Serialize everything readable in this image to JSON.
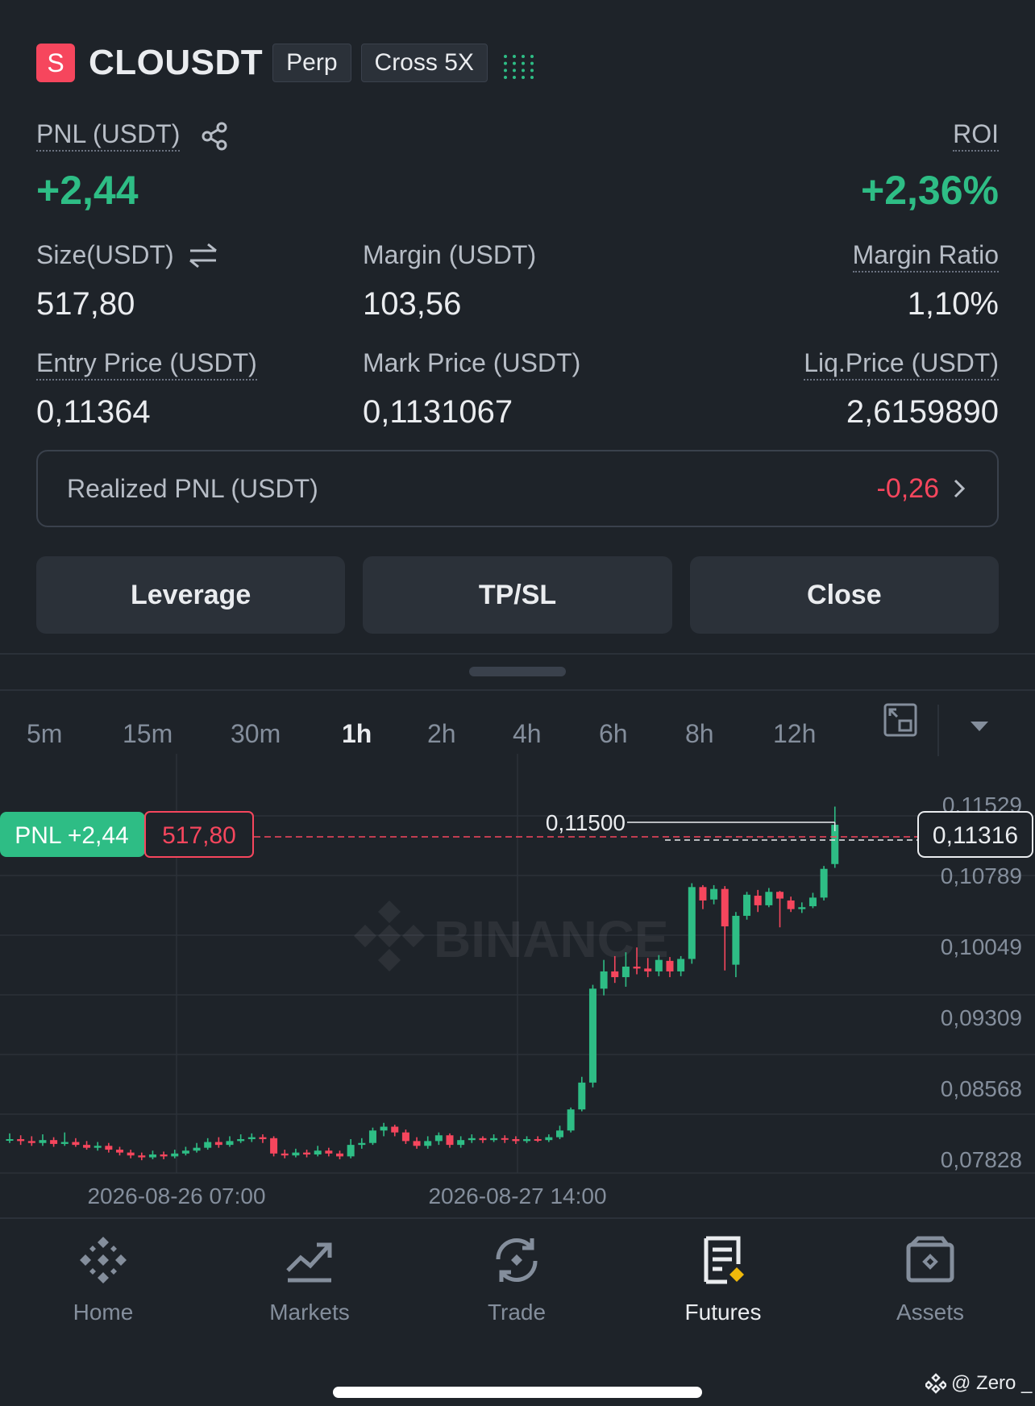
{
  "header": {
    "badge_letter": "S",
    "symbol": "CLOUSDT",
    "tag_contract": "Perp",
    "tag_margin": "Cross 5X"
  },
  "pnl": {
    "label": "PNL (USDT)",
    "value": "+2,44",
    "roi_label": "ROI",
    "roi_value": "+2,36%"
  },
  "stats": {
    "size_label": "Size(USDT)",
    "size_value": "517,80",
    "margin_label": "Margin (USDT)",
    "margin_value": "103,56",
    "margin_ratio_label": "Margin Ratio",
    "margin_ratio_value": "1,10%",
    "entry_label": "Entry Price (USDT)",
    "entry_value": "0,11364",
    "mark_label": "Mark Price (USDT)",
    "mark_value": "0,1131067",
    "liq_label": "Liq.Price (USDT)",
    "liq_value": "2,6159890"
  },
  "realized": {
    "label": "Realized PNL (USDT)",
    "value": "-0,26"
  },
  "buttons": {
    "leverage": "Leverage",
    "tpsl": "TP/SL",
    "close": "Close"
  },
  "timeframes": [
    "5m",
    "15m",
    "30m",
    "1h",
    "2h",
    "4h",
    "6h",
    "8h",
    "12h"
  ],
  "active_timeframe": "1h",
  "chart": {
    "watermark": "BINANCE",
    "pnl_tag_label": "PNL +2,44",
    "pnl_tag_size": "517,80",
    "high_label": "0,11500",
    "current_price": "0,11316",
    "y_labels": [
      "0,11529",
      "0,10789",
      "0,10049",
      "0,09309",
      "0,08568",
      "0,07828"
    ],
    "x_labels": [
      "2026-08-26 07:00",
      "2026-08-27 14:00"
    ],
    "colors": {
      "up": "#2ebd85",
      "down": "#f6465d"
    }
  },
  "chart_data": {
    "type": "candlestick",
    "ylim": [
      0.07828,
      0.11529
    ],
    "y_ticks": [
      0.11529,
      0.10789,
      0.10049,
      0.09309,
      0.08568,
      0.07828
    ],
    "x_ticks": [
      "2026-08-26 07:00",
      "2026-08-27 14:00"
    ],
    "entry_price": 0.11364,
    "current_price": 0.11316,
    "high_marker": 0.115,
    "candles": [
      [
        0.0802,
        0.0803,
        0.0809,
        0.0799
      ],
      [
        0.0803,
        0.0801,
        0.0807,
        0.0797
      ],
      [
        0.0801,
        0.0799,
        0.0806,
        0.0796
      ],
      [
        0.0799,
        0.0802,
        0.0808,
        0.0796
      ],
      [
        0.0802,
        0.0798,
        0.0805,
        0.0795
      ],
      [
        0.0798,
        0.08,
        0.081,
        0.0796
      ],
      [
        0.08,
        0.0797,
        0.0804,
        0.0795
      ],
      [
        0.0797,
        0.0794,
        0.0801,
        0.0792
      ],
      [
        0.0794,
        0.0796,
        0.08,
        0.0791
      ],
      [
        0.0796,
        0.0792,
        0.0799,
        0.0789
      ],
      [
        0.0792,
        0.0789,
        0.0795,
        0.0786
      ],
      [
        0.0789,
        0.0786,
        0.0792,
        0.0783
      ],
      [
        0.0786,
        0.0784,
        0.0789,
        0.0781
      ],
      [
        0.0784,
        0.0787,
        0.0791,
        0.0782
      ],
      [
        0.0787,
        0.0785,
        0.079,
        0.0782
      ],
      [
        0.0785,
        0.0788,
        0.0792,
        0.0783
      ],
      [
        0.0788,
        0.0791,
        0.0795,
        0.0786
      ],
      [
        0.0791,
        0.0794,
        0.0799,
        0.0789
      ],
      [
        0.0794,
        0.08,
        0.0804,
        0.0792
      ],
      [
        0.08,
        0.0797,
        0.0805,
        0.0794
      ],
      [
        0.0797,
        0.0801,
        0.0806,
        0.0795
      ],
      [
        0.0801,
        0.0803,
        0.0808,
        0.0799
      ],
      [
        0.0803,
        0.0805,
        0.0809,
        0.08
      ],
      [
        0.0805,
        0.0803,
        0.0808,
        0.0799
      ],
      [
        0.0804,
        0.0788,
        0.0806,
        0.0785
      ],
      [
        0.0788,
        0.0786,
        0.0792,
        0.0783
      ],
      [
        0.0786,
        0.0789,
        0.0793,
        0.0784
      ],
      [
        0.0789,
        0.0787,
        0.0792,
        0.0784
      ],
      [
        0.0787,
        0.0791,
        0.0796,
        0.0785
      ],
      [
        0.0791,
        0.0788,
        0.0794,
        0.0785
      ],
      [
        0.0788,
        0.0785,
        0.0791,
        0.0782
      ],
      [
        0.0785,
        0.0797,
        0.0803,
        0.0783
      ],
      [
        0.0797,
        0.0799,
        0.0804,
        0.0793
      ],
      [
        0.0799,
        0.0812,
        0.0815,
        0.0797
      ],
      [
        0.0812,
        0.0816,
        0.082,
        0.0806
      ],
      [
        0.0816,
        0.081,
        0.0818,
        0.0806
      ],
      [
        0.081,
        0.0801,
        0.0813,
        0.0798
      ],
      [
        0.0801,
        0.0796,
        0.0805,
        0.0793
      ],
      [
        0.0796,
        0.0801,
        0.0806,
        0.0793
      ],
      [
        0.0801,
        0.0807,
        0.081,
        0.0797
      ],
      [
        0.0807,
        0.0797,
        0.0809,
        0.0794
      ],
      [
        0.0797,
        0.0802,
        0.0806,
        0.0794
      ],
      [
        0.0802,
        0.0804,
        0.0808,
        0.0799
      ],
      [
        0.0804,
        0.0802,
        0.0806,
        0.0799
      ],
      [
        0.0802,
        0.0804,
        0.0808,
        0.08
      ],
      [
        0.0804,
        0.0803,
        0.0807,
        0.0799
      ],
      [
        0.0803,
        0.0801,
        0.0806,
        0.0798
      ],
      [
        0.0801,
        0.0803,
        0.0806,
        0.0799
      ],
      [
        0.0803,
        0.0802,
        0.0806,
        0.08
      ],
      [
        0.0802,
        0.0805,
        0.0808,
        0.08
      ],
      [
        0.0805,
        0.0812,
        0.0817,
        0.0803
      ],
      [
        0.0812,
        0.0834,
        0.0836,
        0.081
      ],
      [
        0.0834,
        0.0862,
        0.0868,
        0.0832
      ],
      [
        0.0862,
        0.096,
        0.0964,
        0.0857
      ],
      [
        0.096,
        0.0978,
        0.099,
        0.0953
      ],
      [
        0.0978,
        0.0972,
        0.0994,
        0.0966
      ],
      [
        0.0972,
        0.0983,
        0.0998,
        0.0962
      ],
      [
        0.0983,
        0.0981,
        0.1003,
        0.0975
      ],
      [
        0.0981,
        0.0978,
        0.0992,
        0.0972
      ],
      [
        0.0978,
        0.099,
        0.0995,
        0.0973
      ],
      [
        0.0989,
        0.0978,
        0.0993,
        0.0972
      ],
      [
        0.0978,
        0.0991,
        0.0994,
        0.0973
      ],
      [
        0.0991,
        0.1066,
        0.107,
        0.0986
      ],
      [
        0.1066,
        0.1052,
        0.1068,
        0.1043
      ],
      [
        0.1053,
        0.1064,
        0.1068,
        0.1048
      ],
      [
        0.1064,
        0.1025,
        0.1067,
        0.0979
      ],
      [
        0.0985,
        0.1036,
        0.104,
        0.0972
      ],
      [
        0.1036,
        0.1058,
        0.1061,
        0.1032
      ],
      [
        0.1057,
        0.1047,
        0.1063,
        0.104
      ],
      [
        0.1047,
        0.1061,
        0.1065,
        0.1045
      ],
      [
        0.1061,
        0.1054,
        0.1062,
        0.1024
      ],
      [
        0.1052,
        0.1043,
        0.1056,
        0.104
      ],
      [
        0.1043,
        0.1045,
        0.105,
        0.1039
      ],
      [
        0.1046,
        0.1055,
        0.106,
        0.1044
      ],
      [
        0.1055,
        0.1085,
        0.1088,
        0.1052
      ],
      [
        0.109,
        0.1131,
        0.115,
        0.1086
      ]
    ]
  }
}
